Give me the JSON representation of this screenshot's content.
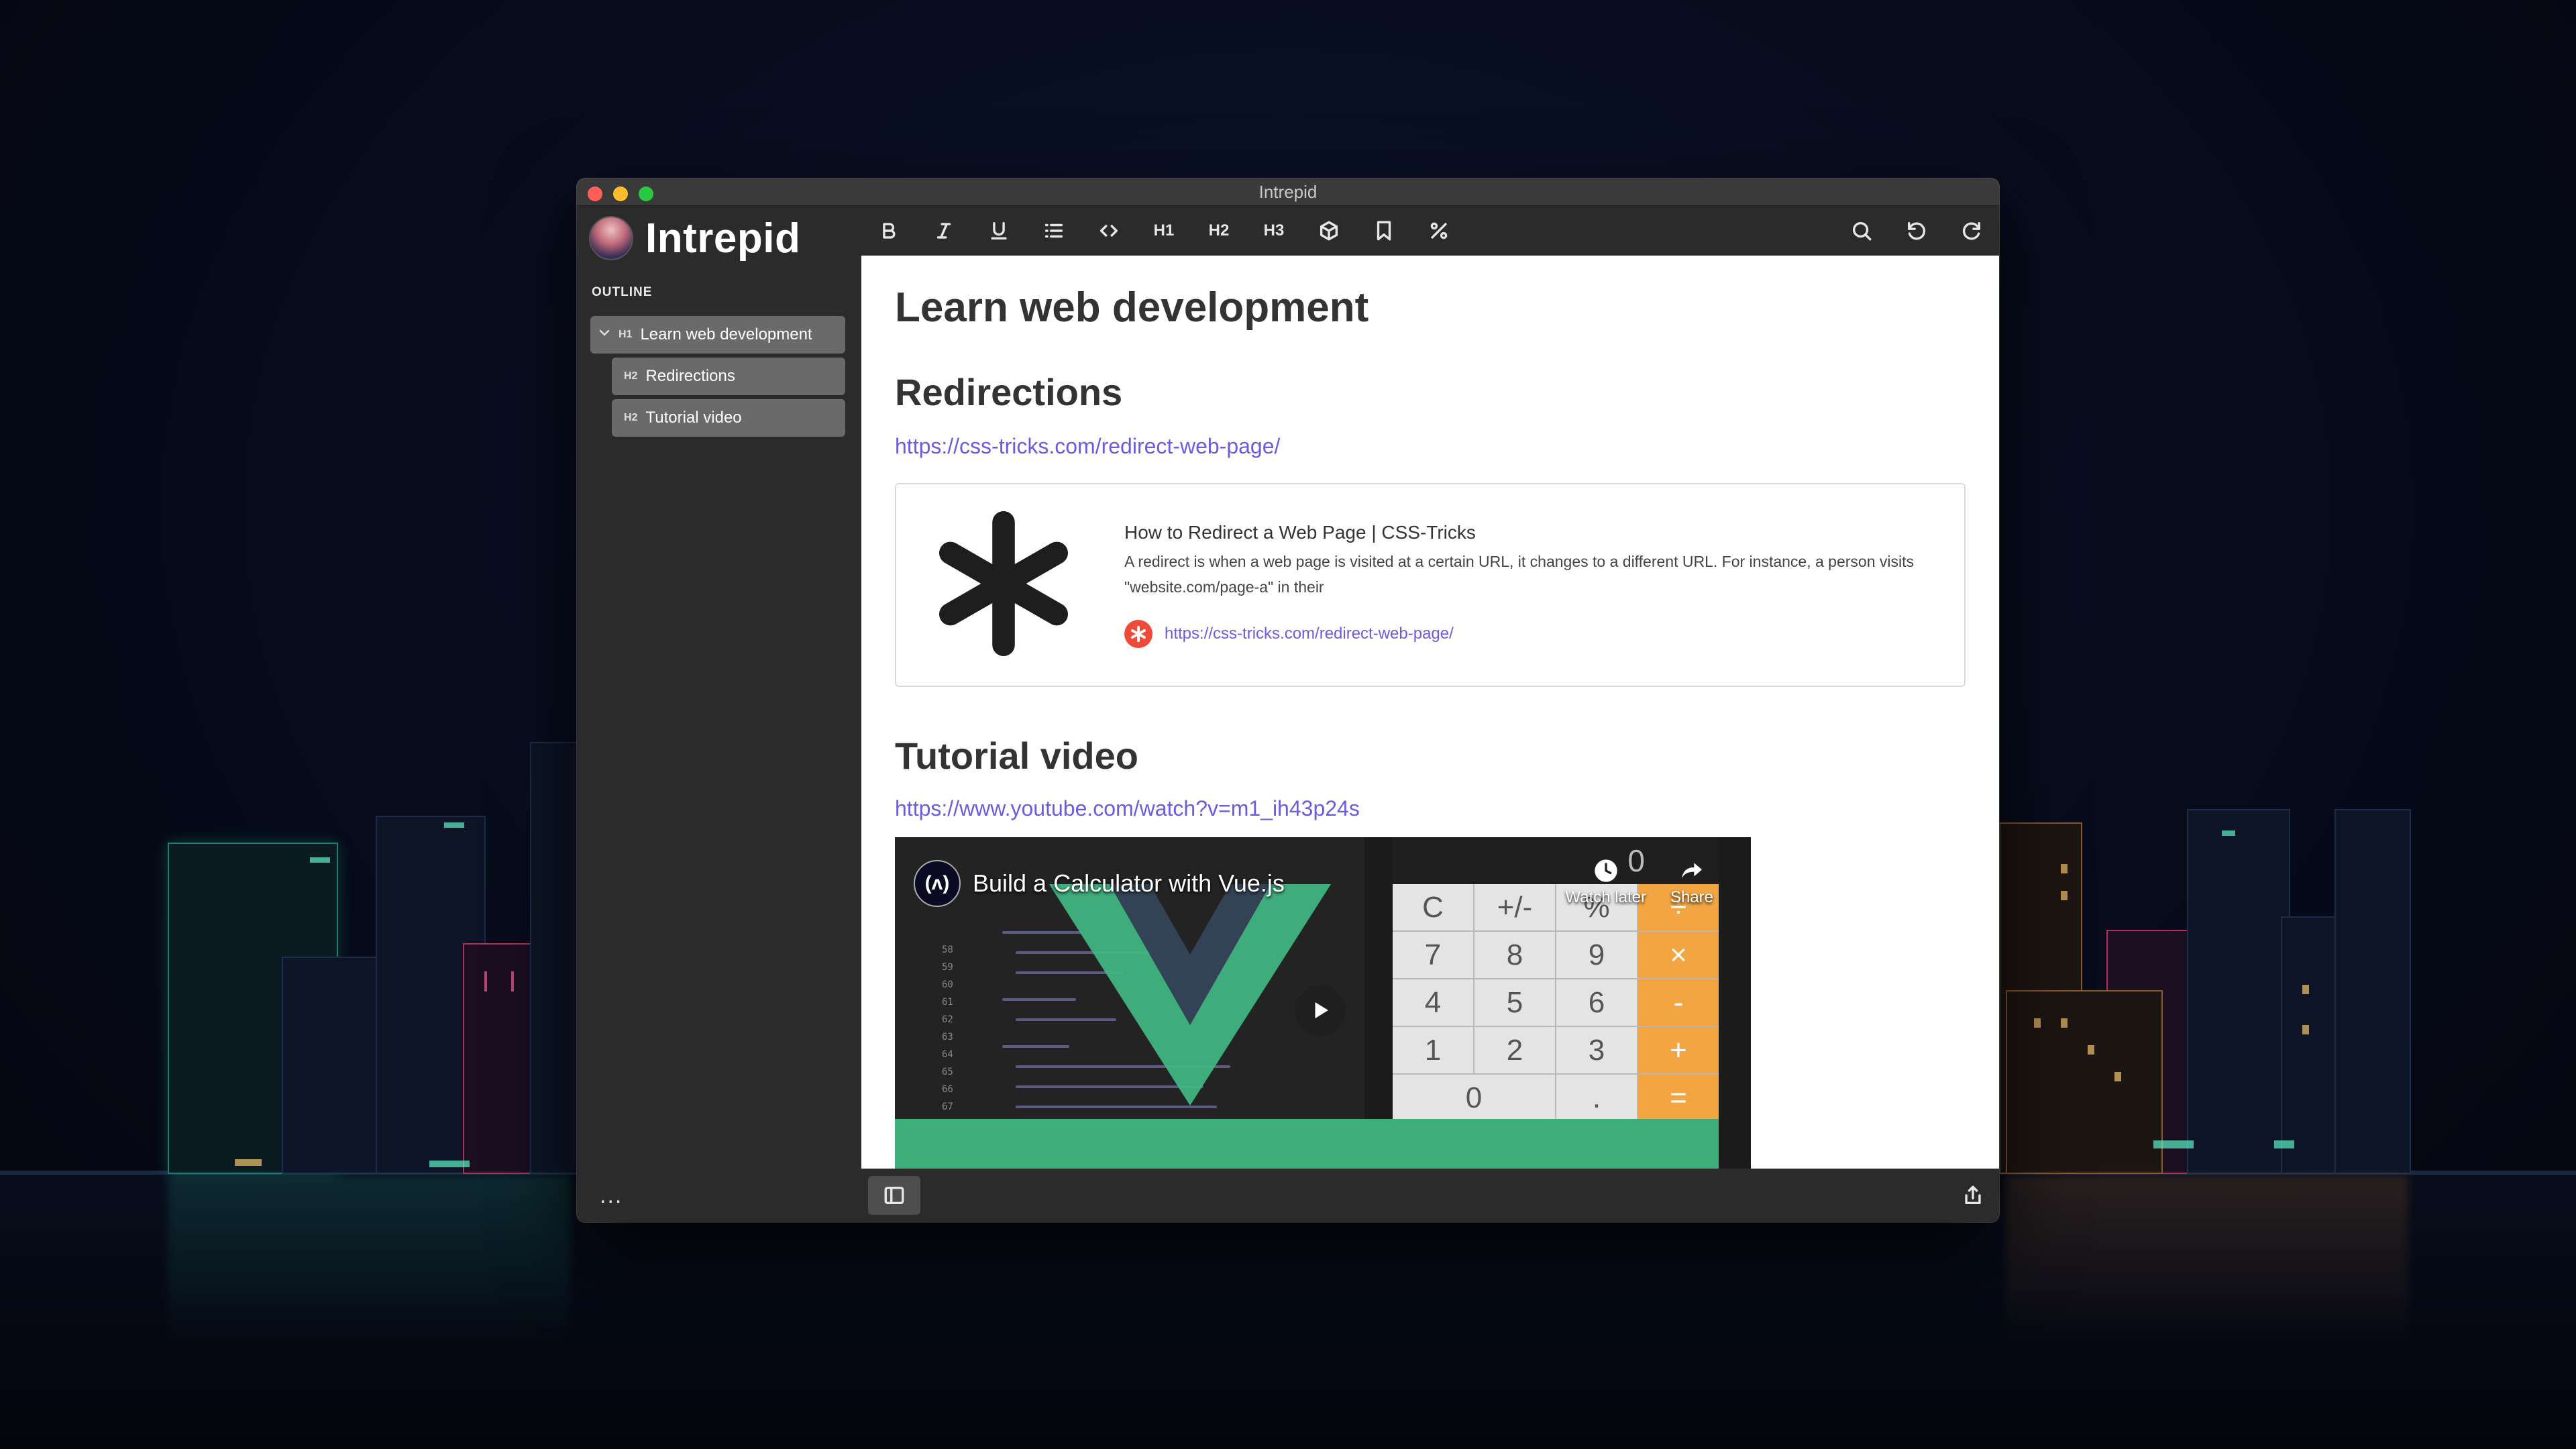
{
  "window": {
    "title": "Intrepid"
  },
  "sidebar": {
    "brand": "Intrepid",
    "outline_label": "OUTLINE",
    "items": [
      {
        "level": "H1",
        "label": "Learn web development"
      },
      {
        "level": "H2",
        "label": "Redirections"
      },
      {
        "level": "H2",
        "label": "Tutorial video"
      }
    ],
    "more": "..."
  },
  "toolbar": {
    "h1": "H1",
    "h2": "H2",
    "h3": "H3",
    "icons": [
      "bold-icon",
      "italic-icon",
      "underline-icon",
      "list-icon",
      "code-icon",
      "h1",
      "h2",
      "h3",
      "cube-icon",
      "bookmark-icon",
      "percent-icon",
      "search-icon",
      "undo-icon",
      "redo-icon"
    ]
  },
  "document": {
    "h1": "Learn web development",
    "sections": [
      {
        "heading": "Redirections",
        "link": "https://css-tricks.com/redirect-web-page/"
      },
      {
        "heading": "Tutorial video",
        "link": "https://www.youtube.com/watch?v=m1_ih43p24s"
      }
    ],
    "card": {
      "title": "How to Redirect a Web Page | CSS-Tricks",
      "description": "A redirect is when a web page is visited at a certain URL, it changes to a different URL. For instance, a person visits \"website.com/page-a\" in their",
      "url": "https://css-tricks.com/redirect-web-page/"
    },
    "video": {
      "title": "Build a Calculator with Vue.js",
      "logo": "(ʌ)",
      "watch_later": "Watch later",
      "share": "Share",
      "calc_display": "0",
      "calc_keys": [
        "C",
        "+/-",
        "%",
        "÷",
        "7",
        "8",
        "9",
        "×",
        "4",
        "5",
        "6",
        "-",
        "1",
        "2",
        "3",
        "+",
        "0",
        ".",
        "="
      ],
      "line_numbers": [
        "58",
        "59",
        "60",
        "61",
        "62",
        "63",
        "64",
        "65",
        "66",
        "67"
      ]
    }
  },
  "colors": {
    "accent": "#6b5be0",
    "sidebar_item": "#6a6a6a",
    "calc_op": "#f2a541",
    "vue_green": "#41b883"
  }
}
